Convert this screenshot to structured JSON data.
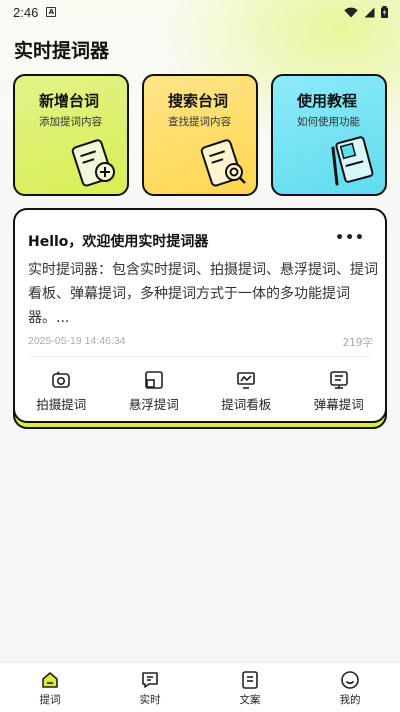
{
  "status_bar": {
    "time": "2:46",
    "notification_icon": "a-icon",
    "icons": [
      "wifi-icon",
      "signal-icon",
      "battery-icon"
    ]
  },
  "page_title": "实时提词器",
  "quick_cards": [
    {
      "title": "新增台词",
      "subtitle": "添加提词内容",
      "icon": "add-document-icon",
      "color": "#d8ee52"
    },
    {
      "title": "搜索台词",
      "subtitle": "查找提词内容",
      "icon": "search-document-icon",
      "color": "#ffd64f"
    },
    {
      "title": "使用教程",
      "subtitle": "如何使用功能",
      "icon": "tutorial-book-icon",
      "color": "#5fdcef"
    }
  ],
  "main_card": {
    "title": "Hello，欢迎使用实时提词器",
    "body": "实时提词器：包含实时提词、拍摄提词、悬浮提词、提词看板、弹幕提词，多种提词方式于一体的多功能提词器。...",
    "date": "2025-05-19 14:46:34",
    "count": "219字",
    "accent_color": "#d9ec3a",
    "actions": [
      {
        "label": "拍摄提词",
        "icon": "camera-icon"
      },
      {
        "label": "悬浮提词",
        "icon": "floating-window-icon"
      },
      {
        "label": "提词看板",
        "icon": "board-icon"
      },
      {
        "label": "弹幕提词",
        "icon": "danmaku-icon"
      }
    ]
  },
  "bottom_nav": [
    {
      "label": "提词",
      "icon": "home-icon",
      "active": true
    },
    {
      "label": "实时",
      "icon": "message-icon"
    },
    {
      "label": "文案",
      "icon": "document-icon"
    },
    {
      "label": "我的",
      "icon": "smile-icon"
    }
  ]
}
